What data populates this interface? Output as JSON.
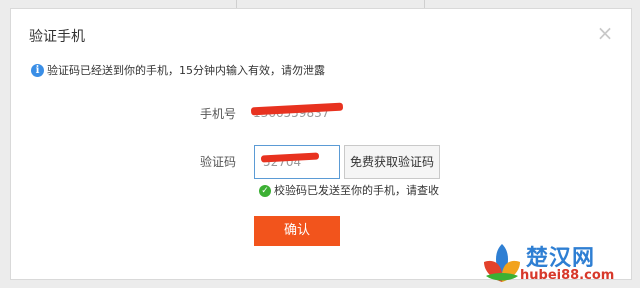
{
  "dialog": {
    "title": "验证手机",
    "close_symbol": "×",
    "notice": "验证码已经送到你的手机，15分钟内输入有效，请勿泄露",
    "notice_icon": "info-icon",
    "phone_label": "手机号",
    "phone_value": "1366559837",
    "code_label": "验证码",
    "code_value": "52704",
    "get_code_label": "免费获取验证码",
    "sent_message": "校验码已发送至你的手机，请查收",
    "sent_icon": "check-icon",
    "confirm_label": "确认"
  },
  "watermark": {
    "title": "楚汉网",
    "url": "hubei88.com"
  },
  "colors": {
    "accent": "#f2541c",
    "info": "#3a8ee6",
    "success": "#3cb034",
    "focus_border": "#5b9bd5",
    "redaction": "#e8321f"
  }
}
